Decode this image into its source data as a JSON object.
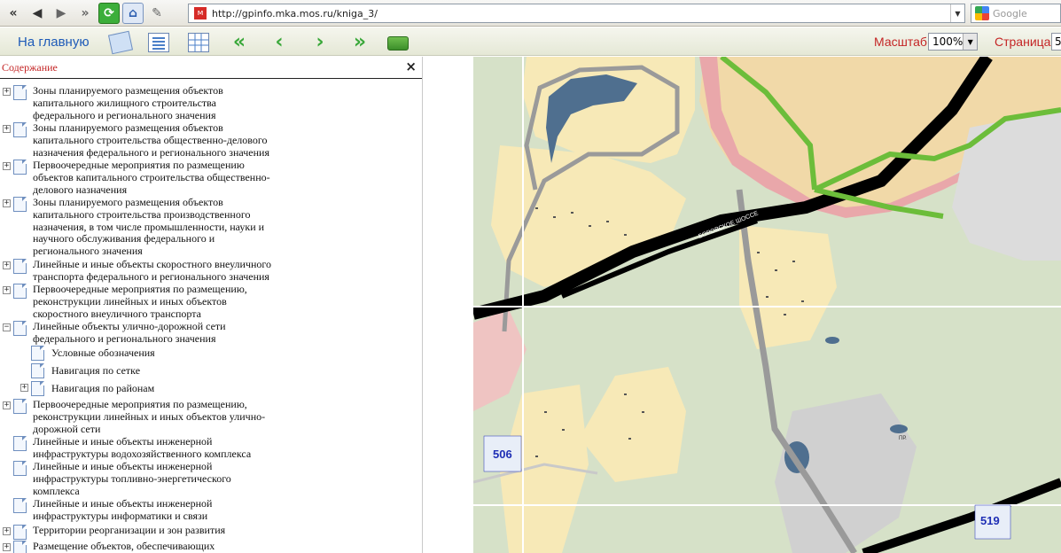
{
  "browser": {
    "url": "http://gpinfo.mka.mos.ru/kniga_3/",
    "search_placeholder": "Google",
    "buttons": [
      "back",
      "back",
      "forward",
      "forward",
      "refresh",
      "home",
      "pencil"
    ]
  },
  "toolbar": {
    "home_label": "На главную",
    "scale_label": "Масштаб",
    "scale_value": "100%",
    "page_label": "Страница",
    "page_value": "5"
  },
  "toc": {
    "title": "Содержание",
    "close_glyph": "×",
    "items": [
      {
        "label": "Зоны планируемого размещения объектов капитального жилищного строительства федерального и регионального значения",
        "expander": "+"
      },
      {
        "label": "Зоны планируемого размещения объектов капитального строительства общественно-делового назначения федерального и регионального значения",
        "expander": "+"
      },
      {
        "label": "Первоочередные мероприятия по размещению объектов капитального строительства общественно-делового назначения",
        "expander": "+"
      },
      {
        "label": "Зоны планируемого размещения объектов капитального строительства производственного назначения, в том числе промышленности, науки и научного обслуживания федерального и регионального значения",
        "expander": "+"
      },
      {
        "label": "Линейные и иные объекты скоростного внеуличного транспорта федерального и регионального значения",
        "expander": "+"
      },
      {
        "label": "Первоочередные мероприятия по размещению, реконструкции линейных и иных объектов скоростного внеуличного транспорта",
        "expander": "+"
      },
      {
        "label": "Линейные объекты улично-дорожной сети федерального и регионального значения",
        "expander": "−"
      },
      {
        "label": "Условные обозначения",
        "expander": ""
      },
      {
        "label": "Навигация по сетке",
        "expander": ""
      },
      {
        "label": "Навигация по районам",
        "expander": "+"
      },
      {
        "label": "Первоочередные мероприятия по размещению, реконструкции линейных и иных объектов улично-дорожной сети",
        "expander": "+"
      },
      {
        "label": "Линейные и иные объекты инженерной инфраструктуры водохозяйственного комплекса",
        "expander": ""
      },
      {
        "label": "Линейные и иные объекты инженерной инфраструктуры топливно-энергетического комплекса",
        "expander": ""
      },
      {
        "label": "Линейные и иные объекты инженерной инфраструктуры информатики и связи",
        "expander": ""
      },
      {
        "label": "Территории реорганизации и зон развития",
        "expander": "+"
      },
      {
        "label": "Размещение объектов, обеспечивающих",
        "expander": "+"
      }
    ]
  },
  "map": {
    "grid_labels": [
      "506",
      "519"
    ],
    "road_label": "БОРОВСКОЕ ШОССЕ",
    "small_label": "ПР.",
    "colors": {
      "forest": "#d6e1c8",
      "residential": "#f7e9b7",
      "urban_block": "#f1d9a8",
      "water": "#4f6f8f",
      "road_major": "#000000",
      "road_secondary": "#9a9a9a",
      "boundary": "#e9a7aa",
      "metro_line": "#6cbd3a",
      "grid": "#ffffff"
    }
  }
}
